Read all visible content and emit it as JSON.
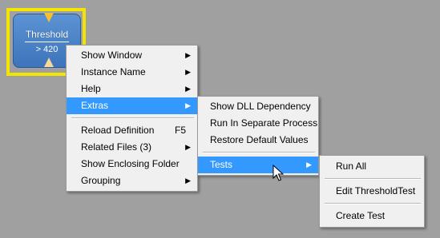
{
  "module": {
    "title": "Threshold",
    "value": "> 420"
  },
  "context_menu": {
    "items": [
      {
        "label": "Show Window",
        "arrow": "▶"
      },
      {
        "label": "Instance Name",
        "arrow": "▶"
      },
      {
        "label": "Help",
        "arrow": "▶"
      },
      {
        "label": "Extras",
        "arrow": "▶"
      },
      {
        "label": "Reload Definition",
        "shortcut": "F5"
      },
      {
        "label": "Related Files (3)",
        "arrow": "▶"
      },
      {
        "label": "Show Enclosing Folder"
      },
      {
        "label": "Grouping",
        "arrow": "▶"
      }
    ]
  },
  "extras_menu": {
    "items": [
      {
        "label": "Show DLL Dependency"
      },
      {
        "label": "Run In Separate Process"
      },
      {
        "label": "Restore Default Values"
      },
      {
        "label": "Tests",
        "arrow": "▶"
      }
    ]
  },
  "tests_menu": {
    "items": [
      {
        "label": "Run All"
      },
      {
        "label": "Edit ThresholdTest"
      },
      {
        "label": "Create Test"
      }
    ]
  },
  "colors": {
    "background": "#a0a0a0",
    "selection_frame": "#f2e600",
    "module": "#4a84c8",
    "highlight": "#3399ff"
  }
}
